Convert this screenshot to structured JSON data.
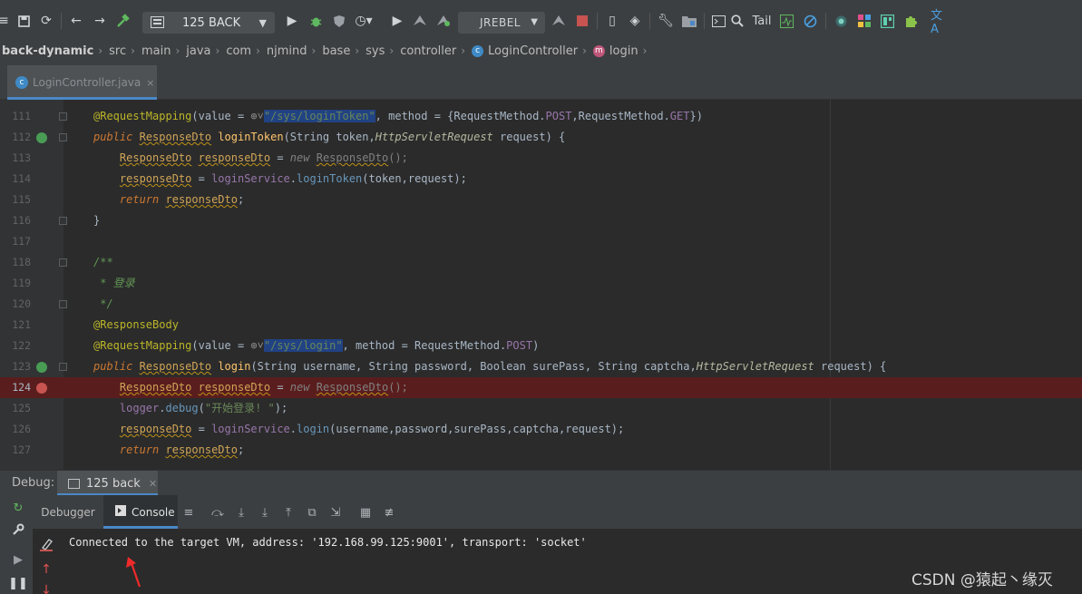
{
  "toolbar": {
    "run_config": "125 BACK",
    "jrebel_label": "JREBEL",
    "tail_label": "Tail"
  },
  "breadcrumb": {
    "items": [
      "back-dynamic",
      "src",
      "main",
      "java",
      "com",
      "njmind",
      "base",
      "sys",
      "controller",
      "LoginController",
      "login"
    ]
  },
  "editor_tab": {
    "filename": "LoginController.java",
    "close": "×"
  },
  "editor": {
    "line_numbers": [
      "111",
      "112",
      "113",
      "114",
      "115",
      "116",
      "117",
      "118",
      "119",
      "120",
      "121",
      "122",
      "123",
      "124",
      "125",
      "126",
      "127"
    ],
    "strings": {
      "login_token_path": "\"/sys/loginToken\"",
      "login_path": "\"/sys/login\"",
      "debug_msg": "\"开始登录! \"",
      "comment_text": "* 登录"
    }
  },
  "debug": {
    "label": "Debug:",
    "session_tab": "125 back",
    "tabs": [
      "Debugger",
      "Console"
    ]
  },
  "console": {
    "output": "Connected to the target VM, address: '192.168.99.125:9001', transport: 'socket'"
  },
  "watermark": "CSDN @猿起丶缘灭",
  "colors": {
    "breakpoint_line": "#5a1d1d",
    "accent": "#4a88c7",
    "keyword": "#cc7832",
    "annotation": "#bbb529",
    "string": "#6a8759"
  }
}
